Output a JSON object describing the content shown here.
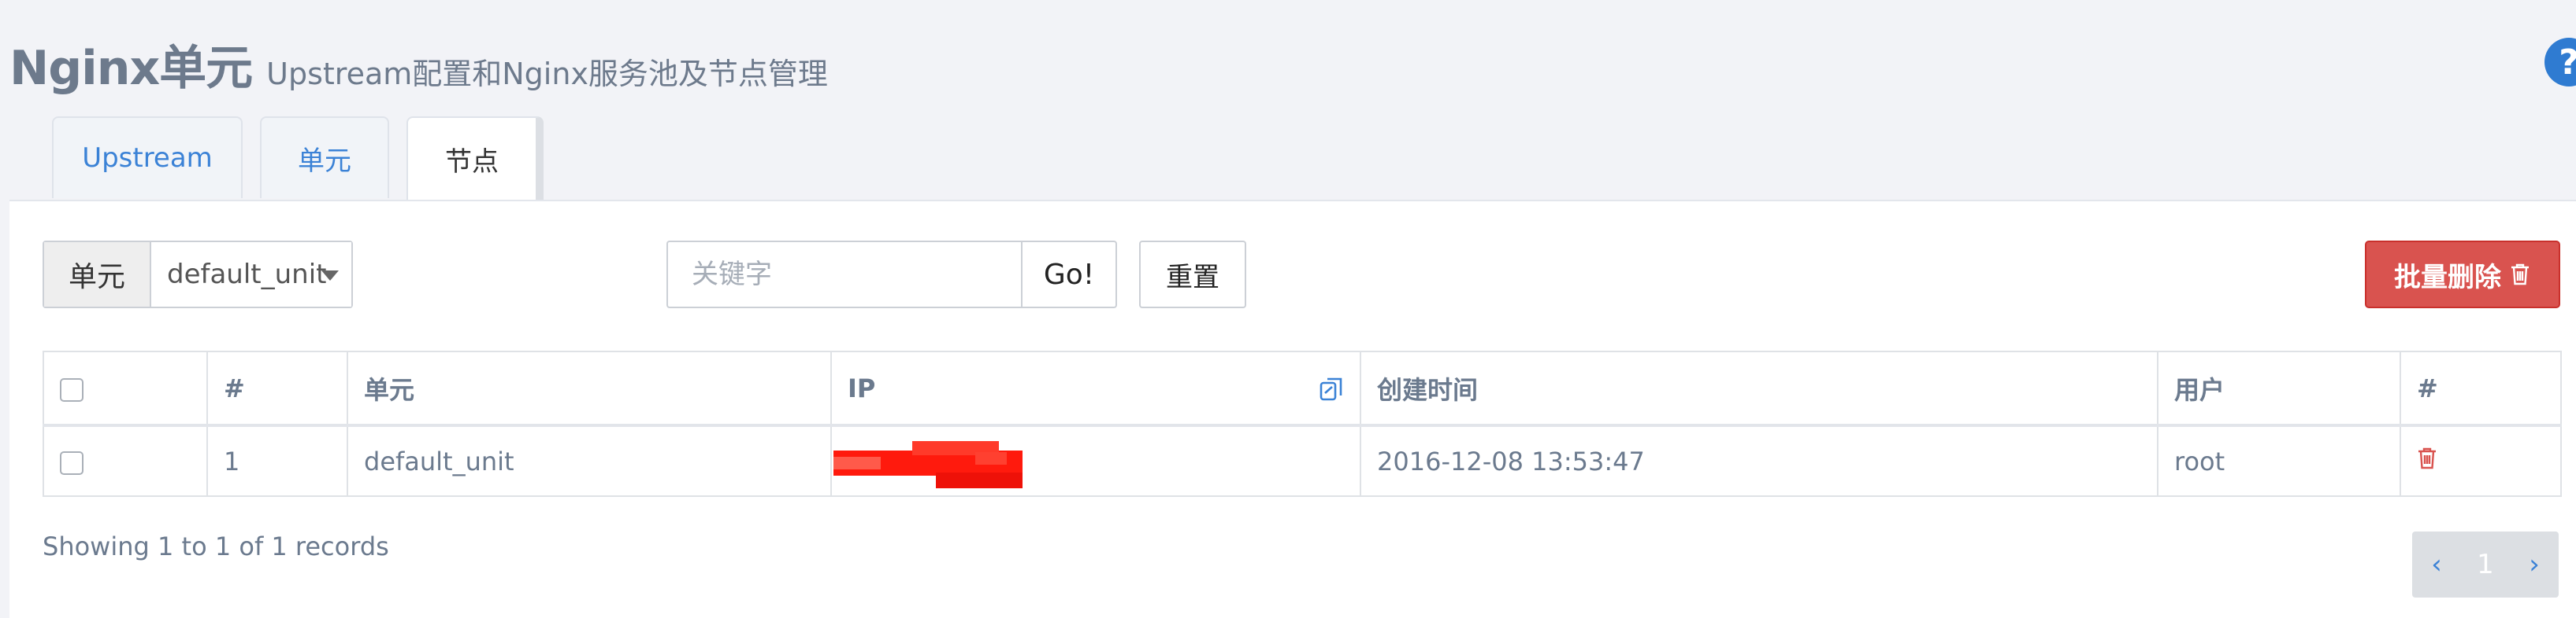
{
  "header": {
    "title": "Nginx单元",
    "subtitle": "Upstream配置和Nginx服务池及节点管理",
    "help_icon": "question-circle-icon"
  },
  "tabs": [
    {
      "label": "Upstream",
      "active": false
    },
    {
      "label": "单元",
      "active": false
    },
    {
      "label": "节点",
      "active": true
    }
  ],
  "toolbar": {
    "unit_label": "单元",
    "unit_selected": "default_unit",
    "search_placeholder": "关键字",
    "go_label": "Go!",
    "reset_label": "重置",
    "batch_delete_label": "批量删除",
    "batch_delete_icon": "trash-icon"
  },
  "table": {
    "headers": [
      "#",
      "单元",
      "IP",
      "创建时间",
      "用户",
      "#"
    ],
    "rows": [
      {
        "index": "1",
        "unit": "default_unit",
        "created": "2016-12-08 13:53:47",
        "user": "root"
      }
    ]
  },
  "footer": {
    "records_info": "Showing 1 to 1 of 1 records",
    "pager_prev": "‹",
    "pager_current": "1",
    "pager_next": "›"
  },
  "colors": {
    "accent": "#3b82d6",
    "danger": "#d9534f",
    "title": "#6d7a8c",
    "redaction": "#ff1a0d"
  }
}
